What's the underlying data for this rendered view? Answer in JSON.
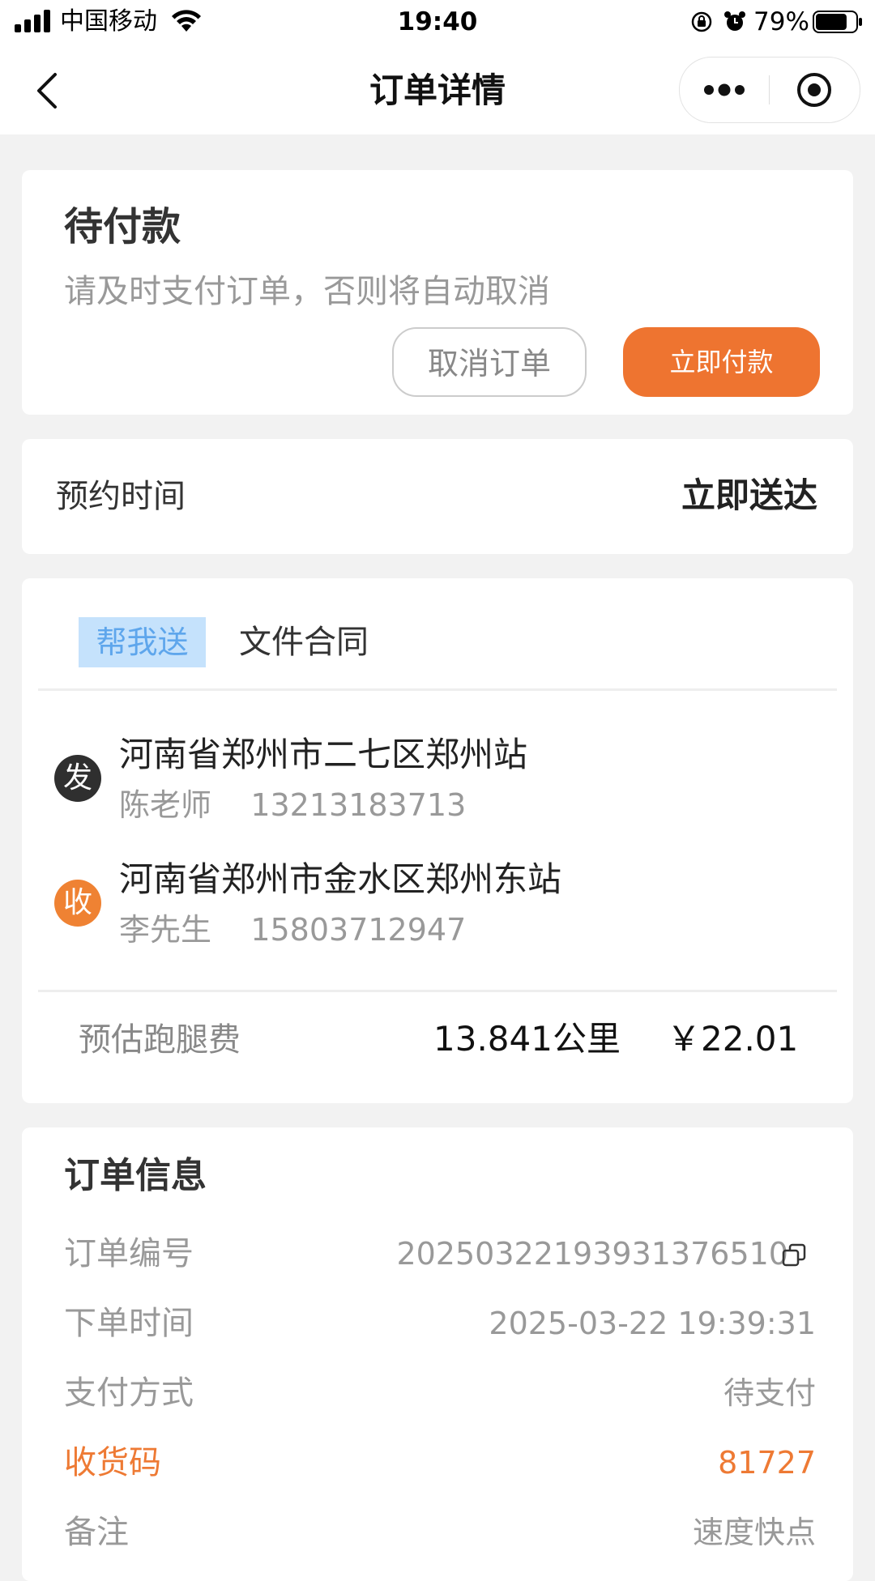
{
  "status_bar": {
    "carrier": "中国移动",
    "time": "19:40",
    "battery_percent": "79%",
    "battery_level": 0.79
  },
  "nav": {
    "title": "订单详情",
    "icons": [
      "back-icon",
      "more-icon",
      "target-icon"
    ]
  },
  "status_card": {
    "title": "待付款",
    "tip": "请及时支付订单，否则将自动取消",
    "cancel_label": "取消订单",
    "pay_label": "立即付款",
    "accent_color": "#ee7430"
  },
  "appointment": {
    "label": "预约时间",
    "value": "立即送达"
  },
  "delivery": {
    "service_tag": "帮我送",
    "category": "文件合同",
    "sender": {
      "badge": "发",
      "address": "河南省郑州市二七区郑州站",
      "contact": "陈老师    13213183713"
    },
    "receiver": {
      "badge": "收",
      "address": "河南省郑州市金水区郑州东站",
      "contact": "李先生    15803712947"
    },
    "fee": {
      "label": "预估跑腿费",
      "distance": "13.841公里",
      "price": "￥22.01"
    }
  },
  "order_info": {
    "title": "订单信息",
    "rows": [
      {
        "label": "订单编号",
        "value": "20250322193931376510"
      },
      {
        "label": "下单时间",
        "value": "2025-03-22 19:39:31"
      },
      {
        "label": "支付方式",
        "value": "待支付"
      },
      {
        "label": "收货码",
        "value": "81727"
      },
      {
        "label": "备注",
        "value": "速度快点"
      }
    ]
  }
}
